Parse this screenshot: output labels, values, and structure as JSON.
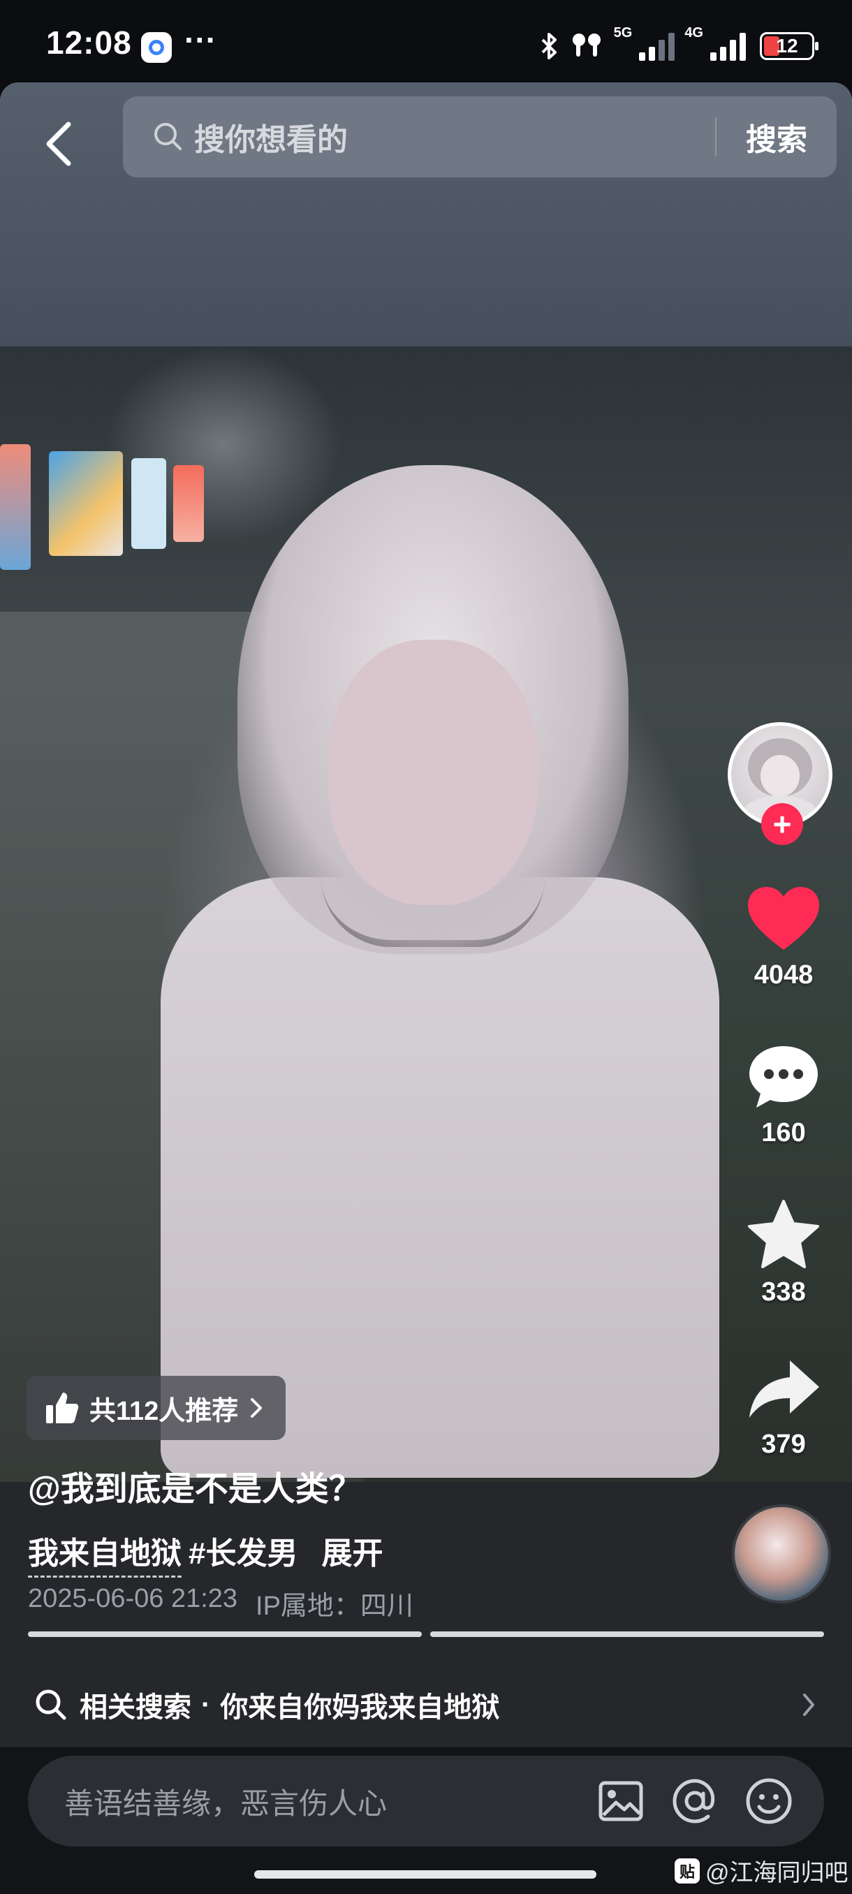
{
  "status_bar": {
    "time": "12:08",
    "more": "···",
    "network_1": "5G",
    "network_2": "4G",
    "battery": "12"
  },
  "search": {
    "placeholder": "搜你想看的",
    "button": "搜索"
  },
  "actions": {
    "likes": "4048",
    "comments": "160",
    "favorites": "338",
    "shares": "379"
  },
  "recommend": {
    "label": "共112人推荐"
  },
  "post": {
    "title": "@我到底是不是人类？",
    "tag_1": "我来自地狱",
    "tag_2": "#长发男",
    "expand": "展开",
    "datetime": "2025-06-06 21:23",
    "ip_location": "IP属地：四川"
  },
  "related": {
    "prefix": "相关搜索",
    "query": "你来自你妈我来自地狱"
  },
  "comment": {
    "placeholder": "善语结善缘，恶言伤人心"
  },
  "watermark": {
    "logo": "贴",
    "text": "@江海同归吧"
  },
  "colors": {
    "like": "#fe2c55",
    "follow": "#fe2c55",
    "panel": "#25272b"
  },
  "icons": [
    "back-icon",
    "search-icon",
    "heart-icon",
    "comment-icon",
    "star-icon",
    "share-icon",
    "thumbs-up-icon",
    "chevron-right-icon",
    "image-icon",
    "at-icon",
    "emoji-icon"
  ]
}
